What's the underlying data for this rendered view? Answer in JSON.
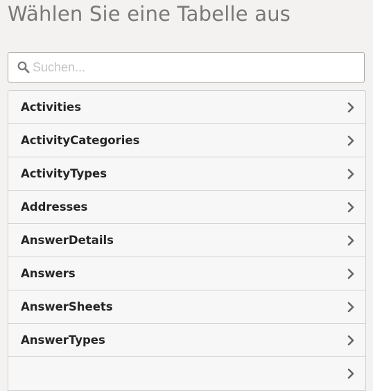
{
  "header": {
    "title": "Wählen Sie eine Tabelle aus"
  },
  "search": {
    "placeholder": "Suchen...",
    "value": "",
    "icon": "search-icon"
  },
  "tables": {
    "item_icon": "chevron-right-icon",
    "items": [
      {
        "label": "Activities"
      },
      {
        "label": "ActivityCategories"
      },
      {
        "label": "ActivityTypes"
      },
      {
        "label": "Addresses"
      },
      {
        "label": "AnswerDetails"
      },
      {
        "label": "Answers"
      },
      {
        "label": "AnswerSheets"
      },
      {
        "label": "AnswerTypes"
      },
      {
        "label": ""
      }
    ]
  }
}
